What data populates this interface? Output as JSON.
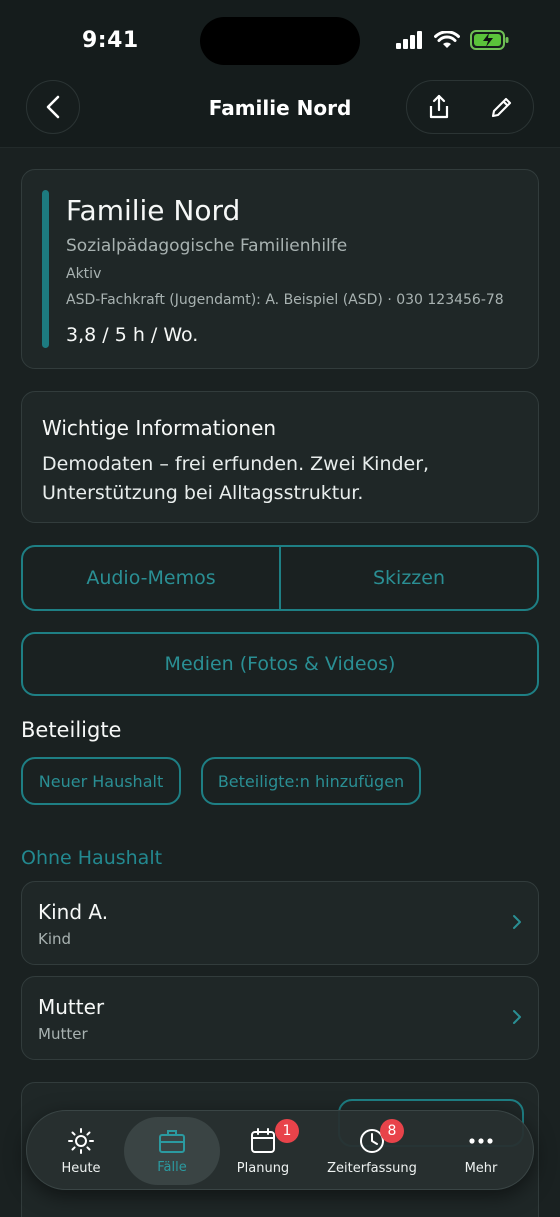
{
  "status_bar": {
    "time": "9:41"
  },
  "header": {
    "title": "Familie Nord"
  },
  "case": {
    "title": "Familie Nord",
    "subtitle": "Sozialpädagogische Familienhilfe",
    "status": "Aktiv",
    "contact": "ASD-Fachkraft (Jugendamt): A. Beispiel (ASD) · 030 123456-78",
    "hours": "3,8 / 5 h / Wo.",
    "accent_color": "#1d7b80"
  },
  "info": {
    "title": "Wichtige Informationen",
    "text": "Demodaten – frei erfunden. Zwei Kinder, Unterstützung bei Alltagsstruktur."
  },
  "actions": {
    "audio_memos": "Audio-Memos",
    "sketches": "Skizzen",
    "media": "Medien (Fotos & Videos)"
  },
  "participants": {
    "title": "Beteiligte",
    "new_household": "Neuer Haushalt",
    "add_participant": "Beteiligte:n hinzufügen",
    "group_title": "Ohne Haushalt",
    "people": [
      {
        "name": "Kind A.",
        "role": "Kind"
      },
      {
        "name": "Mutter",
        "role": "Mutter"
      }
    ]
  },
  "tabbar": {
    "tabs": [
      {
        "label": "Heute",
        "icon": "sun-icon"
      },
      {
        "label": "Fälle",
        "icon": "briefcase-icon"
      },
      {
        "label": "Planung",
        "icon": "calendar-icon",
        "badge": "1"
      },
      {
        "label": "Zeiterfassung",
        "icon": "clock-icon",
        "badge": "8"
      },
      {
        "label": "Mehr",
        "icon": "more-icon"
      }
    ]
  },
  "colors": {
    "accent": "#1e7f84",
    "badge": "#e8434a",
    "background": "#1a2121"
  }
}
